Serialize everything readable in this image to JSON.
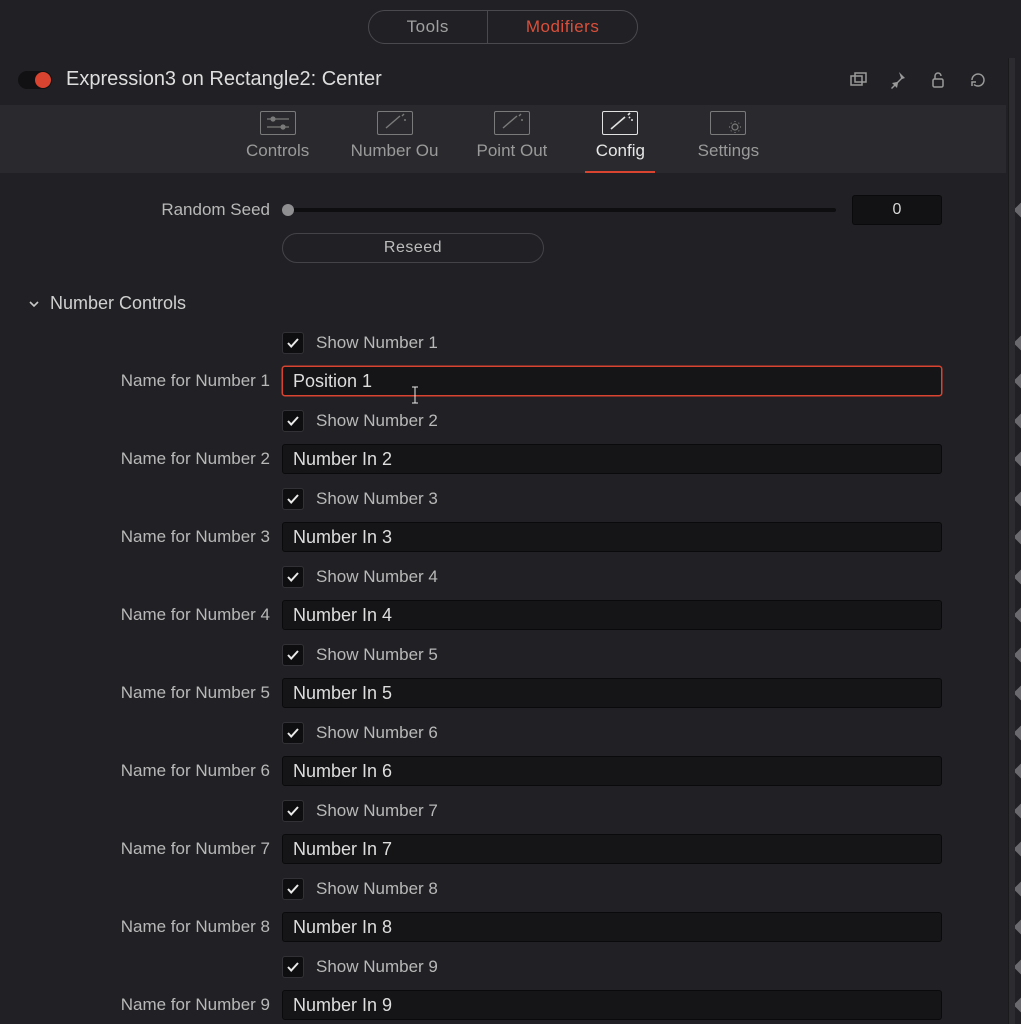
{
  "topTabs": {
    "tools": "Tools",
    "modifiers": "Modifiers",
    "active": "modifiers"
  },
  "title": "Expression3 on Rectangle2: Center",
  "subtabs": {
    "controls": "Controls",
    "numberout": "Number Ou",
    "pointout": "Point Out",
    "config": "Config",
    "settings": "Settings",
    "active": "config"
  },
  "randomSeed": {
    "label": "Random Seed",
    "value": "0",
    "reseed": "Reseed"
  },
  "sectionTitle": "Number Controls",
  "numbers": [
    {
      "showLabel": "Show Number 1",
      "show": true,
      "nameLabel": "Name for Number 1",
      "name": "Position 1",
      "active": true
    },
    {
      "showLabel": "Show Number 2",
      "show": true,
      "nameLabel": "Name for Number 2",
      "name": "Number In 2"
    },
    {
      "showLabel": "Show Number 3",
      "show": true,
      "nameLabel": "Name for Number 3",
      "name": "Number In 3"
    },
    {
      "showLabel": "Show Number 4",
      "show": true,
      "nameLabel": "Name for Number 4",
      "name": "Number In 4"
    },
    {
      "showLabel": "Show Number 5",
      "show": true,
      "nameLabel": "Name for Number 5",
      "name": "Number In 5"
    },
    {
      "showLabel": "Show Number 6",
      "show": true,
      "nameLabel": "Name for Number 6",
      "name": "Number In 6"
    },
    {
      "showLabel": "Show Number 7",
      "show": true,
      "nameLabel": "Name for Number 7",
      "name": "Number In 7"
    },
    {
      "showLabel": "Show Number 8",
      "show": true,
      "nameLabel": "Name for Number 8",
      "name": "Number In 8"
    },
    {
      "showLabel": "Show Number 9",
      "show": true,
      "nameLabel": "Name for Number 9",
      "name": "Number In 9"
    }
  ]
}
